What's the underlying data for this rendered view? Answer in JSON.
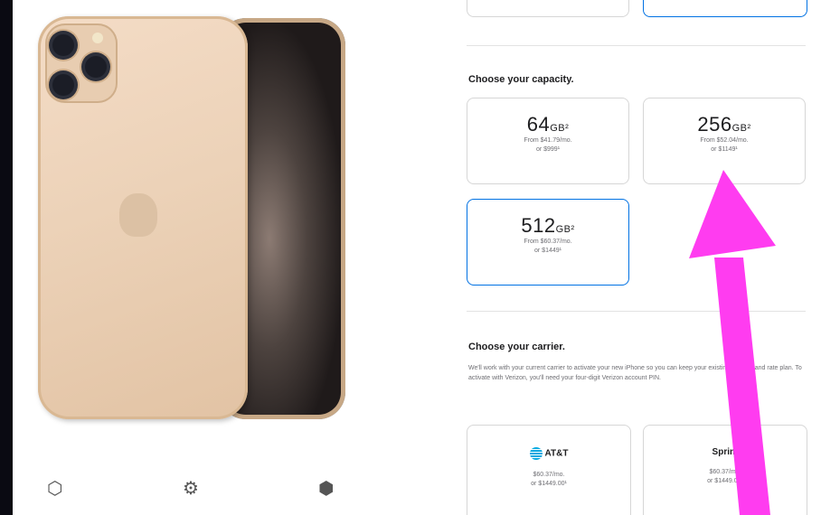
{
  "colors": {
    "accent": "#0071e3",
    "annotation_arrow": "#ff3cf0"
  },
  "product": {
    "bottom_icons": [
      "ar-cube-icon",
      "settings-icon",
      "box-icon"
    ]
  },
  "capacity": {
    "heading": "Choose your capacity.",
    "options": [
      {
        "size": "64",
        "unit": "GB²",
        "monthly": "From $41.79/mo.",
        "price": "or $999¹",
        "selected": false
      },
      {
        "size": "256",
        "unit": "GB²",
        "monthly": "From $52.04/mo.",
        "price": "or $1149¹",
        "selected": false
      },
      {
        "size": "512",
        "unit": "GB²",
        "monthly": "From $60.37/mo.",
        "price": "or $1449¹",
        "selected": true
      }
    ]
  },
  "carrier": {
    "heading": "Choose your carrier.",
    "description": "We'll work with your current carrier to activate your new iPhone so you can keep your existing number and rate plan. To activate with Verizon, you'll need your four-digit Verizon account PIN.",
    "options": [
      {
        "name": "AT&T",
        "monthly": "$60.37/mo.",
        "price": "or $1449.00¹"
      },
      {
        "name": "Sprint",
        "monthly": "$60.37/mo.",
        "price": "or $1449.00¹"
      }
    ]
  }
}
